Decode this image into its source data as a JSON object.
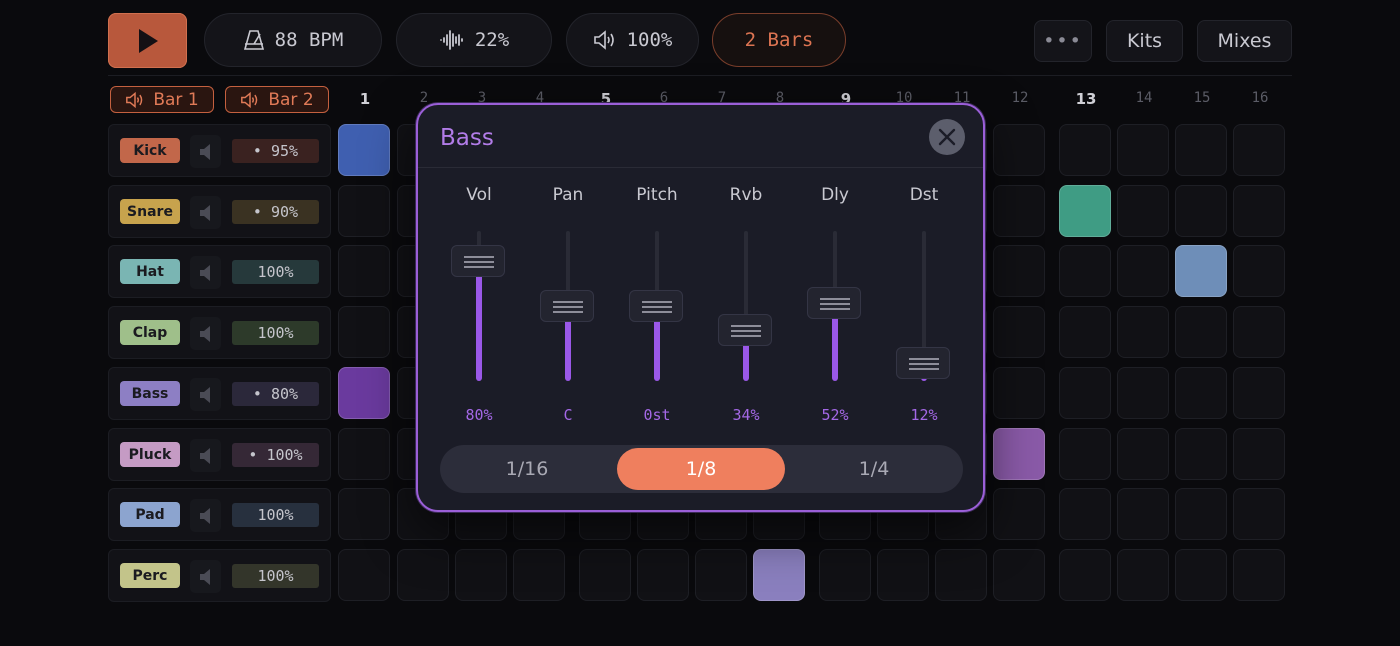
{
  "transport": {
    "play_label": "",
    "tempo": "88 BPM",
    "swing": "22%",
    "volume": "100%",
    "length": "2 Bars"
  },
  "menu": {
    "more_label": "•••",
    "kits_label": "Kits",
    "mixes_label": "Mixes"
  },
  "bars": [
    {
      "label": "Bar 1"
    },
    {
      "label": "Bar 2"
    }
  ],
  "steps": [
    "1",
    "2",
    "3",
    "4",
    "5",
    "6",
    "7",
    "8",
    "9",
    "10",
    "11",
    "12",
    "13",
    "14",
    "15",
    "16"
  ],
  "tracks": [
    {
      "name": "Kick",
      "color": "#c2674a",
      "volume": "• 95%",
      "vol_bg": "#3a2220"
    },
    {
      "name": "Snare",
      "color": "#c7a34d",
      "volume": "• 90%",
      "vol_bg": "#3a3222"
    },
    {
      "name": "Hat",
      "color": "#7ab5b3",
      "volume": "100%",
      "vol_bg": "#26393b"
    },
    {
      "name": "Clap",
      "color": "#9fbf8a",
      "volume": "100%",
      "vol_bg": "#2d3a2a"
    },
    {
      "name": "Bass",
      "color": "#8d7fc4",
      "volume": "• 80%",
      "vol_bg": "#2b283a"
    },
    {
      "name": "Pluck",
      "color": "#c59bc4",
      "volume": "• 100%",
      "vol_bg": "#352836"
    },
    {
      "name": "Pad",
      "color": "#8ca4cf",
      "volume": "100%",
      "vol_bg": "#27303e"
    },
    {
      "name": "Perc",
      "color": "#c3c48a",
      "volume": "100%",
      "vol_bg": "#33352a"
    }
  ],
  "active_steps": [
    {
      "track": 0,
      "step": 1,
      "color": "#3f5fb0"
    },
    {
      "track": 1,
      "step": 13,
      "color": "#3f9c84"
    },
    {
      "track": 2,
      "step": 15,
      "color": "#6e8eb8"
    },
    {
      "track": 4,
      "step": 1,
      "color": "#6a3a9e"
    },
    {
      "track": 5,
      "step": 12,
      "color": "#8a5aa8"
    },
    {
      "track": 7,
      "step": 8,
      "color": "#8a7fbe"
    }
  ],
  "modal": {
    "title": "Bass",
    "faders": [
      {
        "label": "Vol",
        "value": "80%",
        "level": 0.8
      },
      {
        "label": "Pan",
        "value": "C",
        "level": 0.5
      },
      {
        "label": "Pitch",
        "value": "0st",
        "level": 0.5
      },
      {
        "label": "Rvb",
        "value": "34%",
        "level": 0.34
      },
      {
        "label": "Dly",
        "value": "52%",
        "level": 0.52
      },
      {
        "label": "Dst",
        "value": "12%",
        "level": 0.12
      }
    ],
    "note_lengths": [
      {
        "label": "1/16",
        "active": false
      },
      {
        "label": "1/8",
        "active": true
      },
      {
        "label": "1/4",
        "active": false
      }
    ]
  },
  "colors": {
    "accent": "#ef7f5e",
    "modal_accent": "#9b5fd8"
  }
}
